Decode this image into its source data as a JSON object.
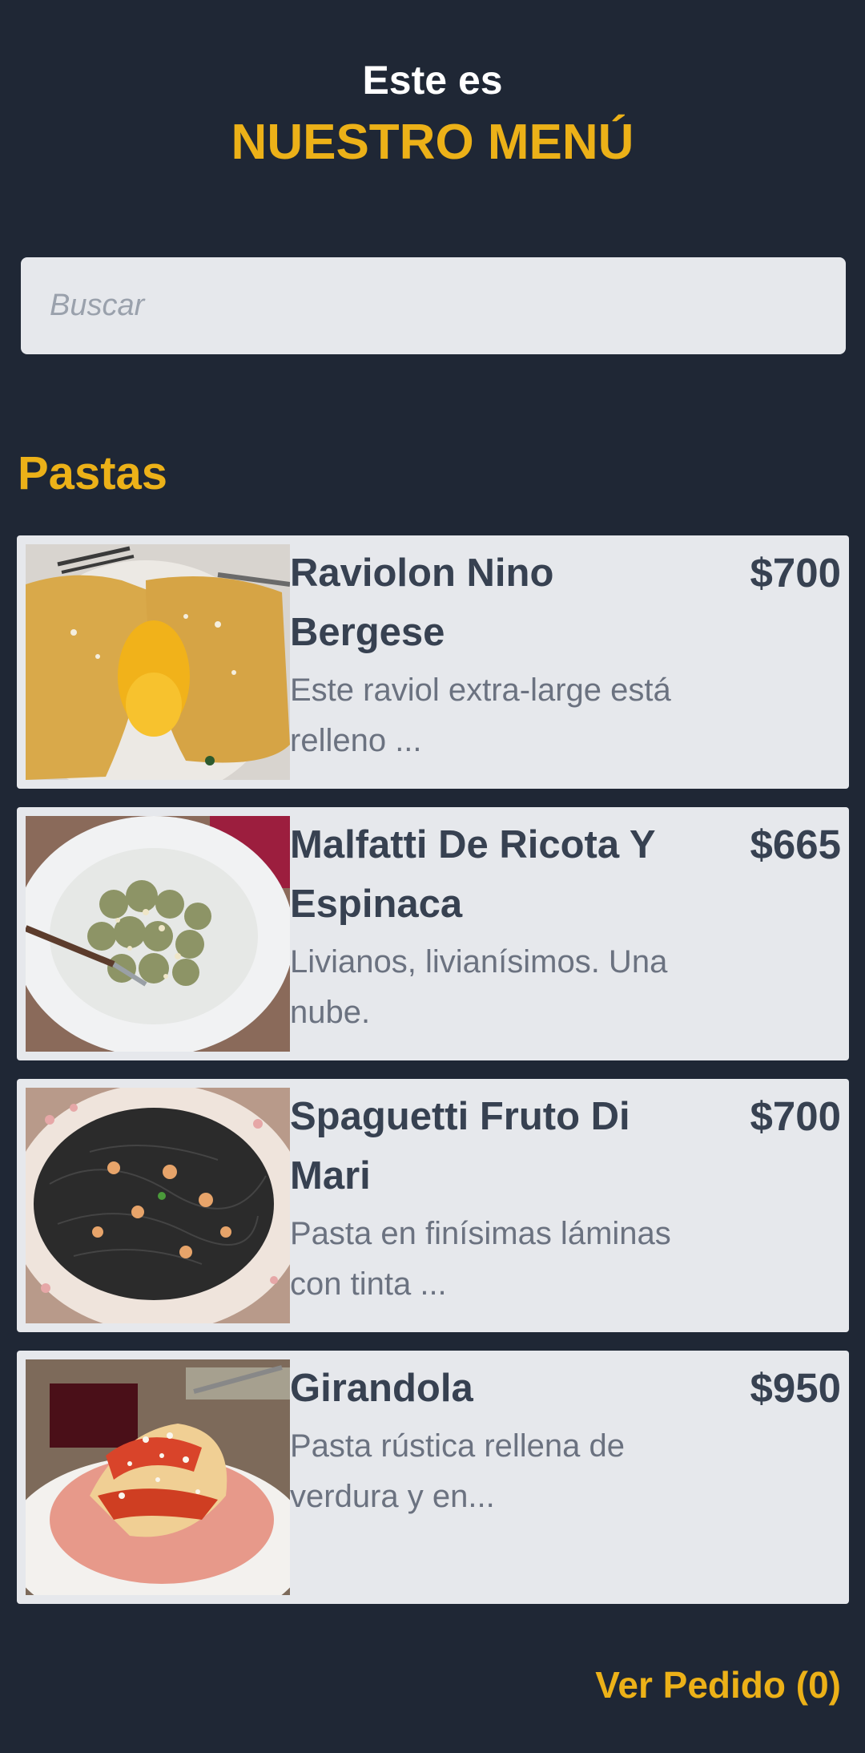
{
  "header": {
    "subtitle": "Este es",
    "title": "NUESTRO MENÚ"
  },
  "search": {
    "placeholder": "Buscar",
    "value": ""
  },
  "section": {
    "title": "Pastas"
  },
  "items": [
    {
      "name": "Raviolon Nino Bergese",
      "description": "Este raviol extra-large está relleno ...",
      "price": "$700",
      "image_icon": "ravioli-photo"
    },
    {
      "name": "Malfatti De Ricota Y Espinaca",
      "description": "Livianos, livianísimos. Una nube.",
      "price": "$665",
      "image_icon": "malfatti-photo"
    },
    {
      "name": "Spaguetti Fruto Di Mari",
      "description": "Pasta en finísimas láminas con tinta ...",
      "price": "$700",
      "image_icon": "spaghetti-photo"
    },
    {
      "name": "Girandola",
      "description": "Pasta rústica rellena de verdura y en...",
      "price": "$950",
      "image_icon": "girandola-photo"
    }
  ],
  "footer": {
    "order_label": "Ver Pedido (0)"
  },
  "colors": {
    "background": "#1f2735",
    "accent": "#ecb118",
    "card": "#e6e8ec",
    "text_dark": "#374151",
    "text_muted": "#6b7280"
  }
}
